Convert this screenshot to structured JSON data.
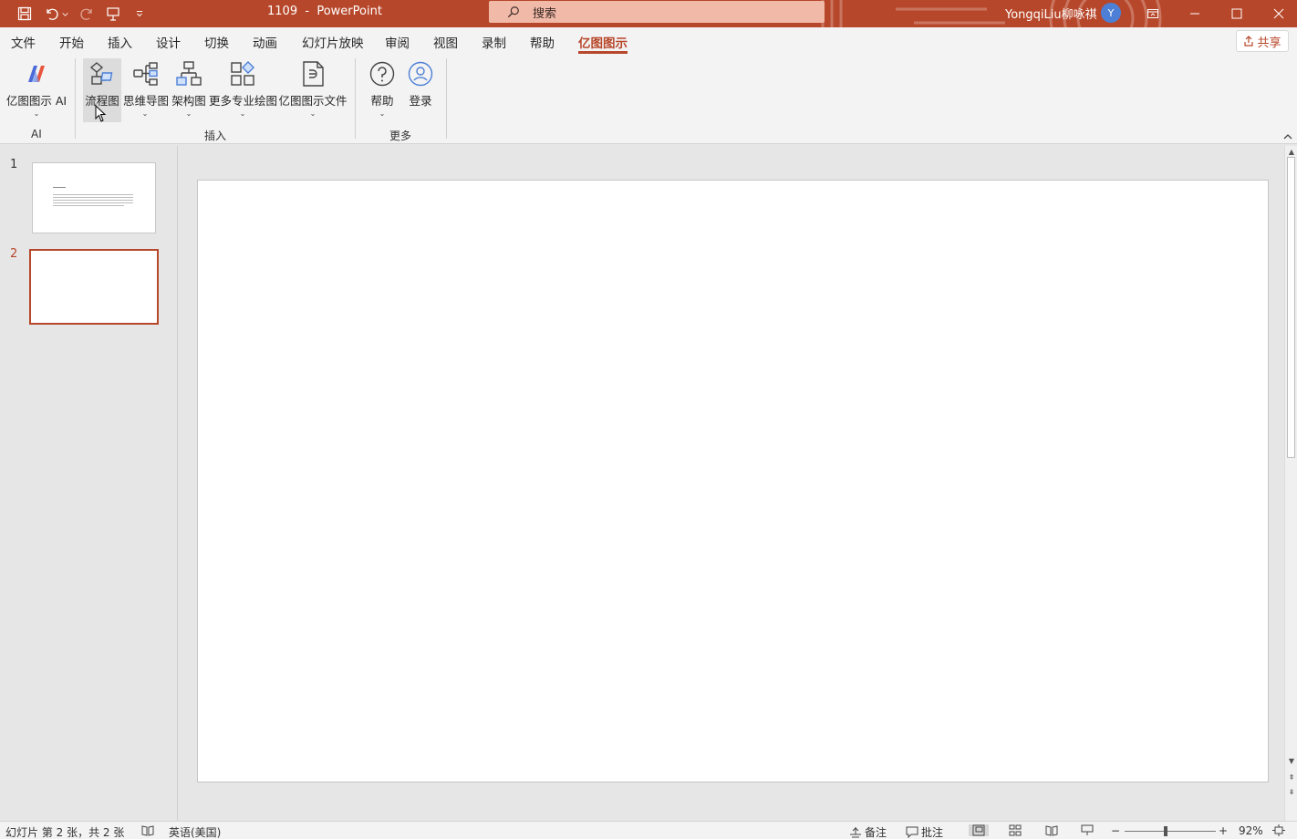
{
  "title_bar": {
    "doc_name": "1109",
    "separator": "-",
    "app_name": "PowerPoint",
    "search_placeholder": "搜索",
    "user_name": "YongqiLiu柳咏祺",
    "avatar_initial": "Y",
    "accent_color": "#b7472a"
  },
  "menu_tabs": [
    "文件",
    "开始",
    "插入",
    "设计",
    "切换",
    "动画",
    "幻灯片放映",
    "审阅",
    "视图",
    "录制",
    "帮助",
    "亿图图示"
  ],
  "active_tab": "亿图图示",
  "share_label": "共享",
  "ribbon": {
    "groups": [
      {
        "label": "AI",
        "buttons": [
          {
            "label": "亿图图示 AI",
            "icon": "edraw-ai-icon"
          }
        ]
      },
      {
        "label": "插入",
        "buttons": [
          {
            "label": "流程图",
            "icon": "flowchart-icon"
          },
          {
            "label": "思维导图",
            "icon": "mindmap-icon"
          },
          {
            "label": "架构图",
            "icon": "org-chart-icon"
          },
          {
            "label": "更多专业绘图",
            "icon": "more-diagrams-icon"
          },
          {
            "label": "亿图图示文件",
            "icon": "edraw-file-icon"
          }
        ]
      },
      {
        "label": "更多",
        "buttons": [
          {
            "label": "帮助",
            "icon": "help-icon"
          },
          {
            "label": "登录",
            "icon": "user-login-icon"
          }
        ]
      }
    ]
  },
  "slides": [
    {
      "number": "1",
      "active": false
    },
    {
      "number": "2",
      "active": true
    }
  ],
  "status_bar": {
    "slide_info": "幻灯片 第 2 张，共 2 张",
    "language": "英语(美国)",
    "notes": "备注",
    "comments": "批注",
    "zoom": "92%",
    "zoom_minus": "−",
    "zoom_plus": "+"
  }
}
